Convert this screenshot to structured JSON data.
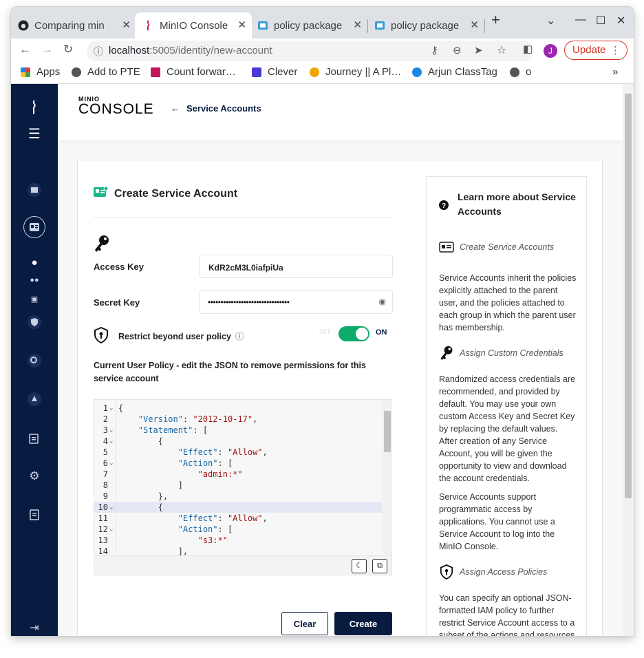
{
  "browser": {
    "tabs": [
      {
        "title": "Comparing min"
      },
      {
        "title": "MinIO Console"
      },
      {
        "title": "policy package"
      },
      {
        "title": "policy package"
      }
    ],
    "url_host": "localhost",
    "url_path": ":5005/identity/new-account",
    "update_label": "Update",
    "profile_initial": "J",
    "bookmarks": [
      {
        "label": "Apps",
        "color": "#e53935"
      },
      {
        "label": "Add to PTE",
        "color": "#555555"
      },
      {
        "label": "Count forwar…",
        "color": "#c2185b"
      },
      {
        "label": "Clever",
        "color": "#4a3bd6"
      },
      {
        "label": "Journey || A Pl…",
        "color": "#f0a500"
      },
      {
        "label": "Arjun ClassTag",
        "color": "#1e88e5"
      },
      {
        "label": "o",
        "color": "#555555"
      }
    ]
  },
  "header": {
    "logo_top": "MINIO",
    "logo_bottom": "CONSOLE",
    "back_label": "Service Accounts"
  },
  "form": {
    "title": "Create Service Account",
    "access_key_label": "Access Key",
    "access_key_value": "KdR2cM3L0iafpiUa",
    "secret_key_label": "Secret Key",
    "secret_key_value": "••••••••••••••••••••••••••••••••",
    "restrict_label": "Restrict beyond user policy",
    "toggle_off": "OFF",
    "toggle_on": "ON",
    "toggle_state": true,
    "policy_label": "Current User Policy - edit the JSON to remove permissions for this service account",
    "clear_label": "Clear",
    "create_label": "Create"
  },
  "editor": {
    "lines": [
      {
        "n": "1",
        "fold": true,
        "code": "{"
      },
      {
        "n": "2",
        "fold": false,
        "code": "    \"Version\": \"2012-10-17\","
      },
      {
        "n": "3",
        "fold": true,
        "code": "    \"Statement\": ["
      },
      {
        "n": "4",
        "fold": true,
        "code": "        {"
      },
      {
        "n": "5",
        "fold": false,
        "code": "            \"Effect\": \"Allow\","
      },
      {
        "n": "6",
        "fold": true,
        "code": "            \"Action\": ["
      },
      {
        "n": "7",
        "fold": false,
        "code": "                \"admin:*\""
      },
      {
        "n": "8",
        "fold": false,
        "code": "            ]"
      },
      {
        "n": "9",
        "fold": false,
        "code": "        },"
      },
      {
        "n": "10",
        "fold": true,
        "code": "        {",
        "highlight": true
      },
      {
        "n": "11",
        "fold": false,
        "code": "            \"Effect\": \"Allow\","
      },
      {
        "n": "12",
        "fold": true,
        "code": "            \"Action\": ["
      },
      {
        "n": "13",
        "fold": false,
        "code": "                \"s3:*\""
      },
      {
        "n": "14",
        "fold": false,
        "code": "            ],"
      }
    ]
  },
  "help": {
    "title": "Learn more about Service Accounts",
    "sec1_title": "Create Service Accounts",
    "sec1_text": "Service Accounts inherit the policies explicitly attached to the parent user, and the policies attached to each group in which the parent user has membership.",
    "sec2_title": "Assign Custom Credentials",
    "sec2_text": "Randomized access credentials are recommended, and provided by default. You may use your own custom Access Key and Secret Key by replacing the default values. After creation of any Service Account, you will be given the opportunity to view and download the account credentials.",
    "sec2_text2": "Service Accounts support programmatic access by applications. You cannot use a Service Account to log into the MinIO Console.",
    "sec3_title": "Assign Access Policies",
    "sec3_text": "You can specify an optional JSON-formatted IAM policy to further restrict Service Account access to a subset of the actions and resources"
  }
}
